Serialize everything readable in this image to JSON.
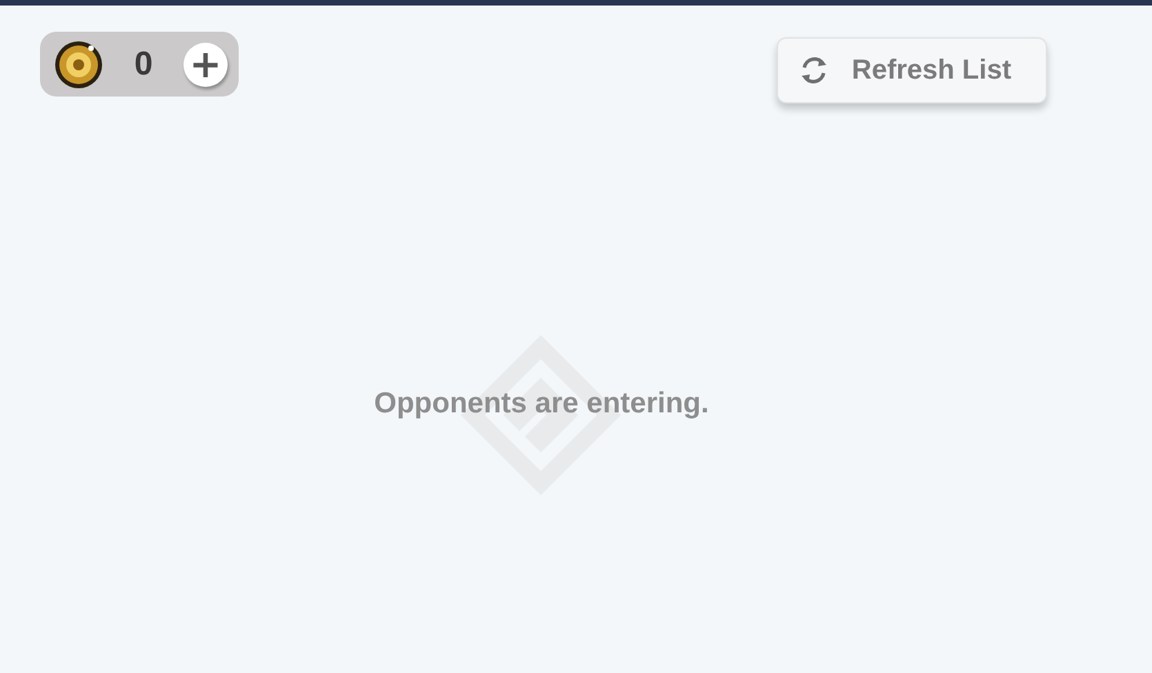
{
  "currency": {
    "amount": "0",
    "add_label": "+"
  },
  "refresh_button": {
    "label": "Refresh List"
  },
  "message": "Opponents are entering."
}
